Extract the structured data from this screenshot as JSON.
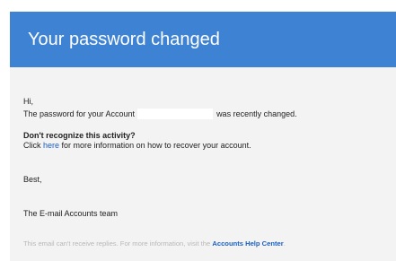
{
  "header": {
    "title": "Your password changed"
  },
  "body": {
    "greeting": "Hi,",
    "password_prefix": "The password for your Account",
    "password_suffix": "was recently changed.",
    "warning_title": "Don't recognize this activity?",
    "click_prefix": "Click",
    "click_link": "here",
    "click_suffix": "for more information on how to recover your account.",
    "sign_off": "Best,",
    "signature": "The E-mail Accounts team"
  },
  "footer": {
    "text": "This email can't receive replies. For more information, visit the",
    "link": "Accounts Help Center",
    "trailing": "."
  },
  "colors": {
    "header_bg": "#3e82d4",
    "body_bg": "#f3f3f3",
    "link": "#1a5fbf"
  }
}
